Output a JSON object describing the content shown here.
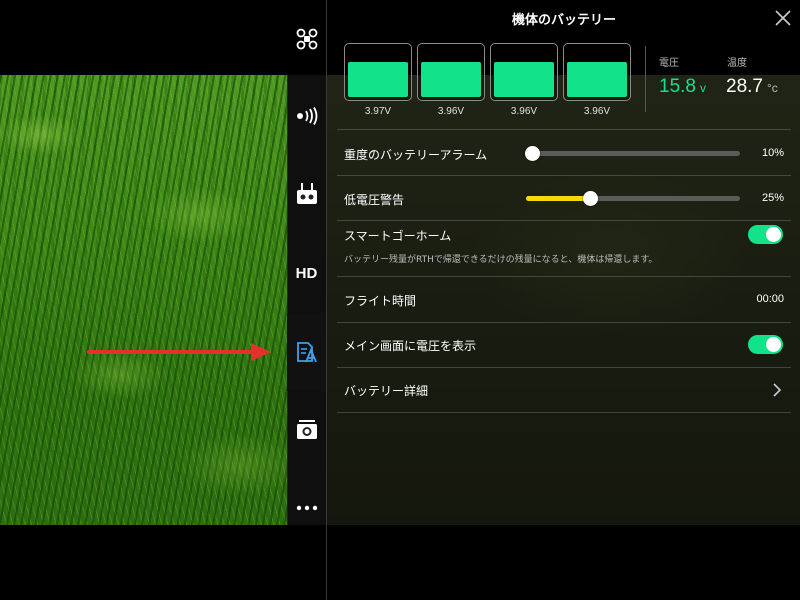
{
  "panel": {
    "title": "機体のバッテリー",
    "cells": [
      {
        "voltage": "3.97V",
        "level": 0.63
      },
      {
        "voltage": "3.96V",
        "level": 0.63
      },
      {
        "voltage": "3.96V",
        "level": 0.63
      },
      {
        "voltage": "3.96V",
        "level": 0.63
      }
    ],
    "voltage_label": "電圧",
    "voltage_value": "15.8",
    "voltage_unit": "v",
    "temp_label": "温度",
    "temp_value": "28.7",
    "temp_unit": "°c"
  },
  "settings": {
    "critical_alarm": {
      "label": "重度のバッテリーアラーム",
      "value": "10%",
      "level": 0.03
    },
    "low_voltage": {
      "label": "低電圧警告",
      "value": "25%",
      "level": 0.3
    },
    "smart_rth": {
      "label": "スマートゴーホーム",
      "on": true,
      "description": "バッテリー残量がRTHで帰還できるだけの残量になると、機体は帰還します。"
    },
    "flight_time": {
      "label": "フライト時間",
      "value": "00:00"
    },
    "show_voltage": {
      "label": "メイン画面に電圧を表示",
      "on": true
    },
    "battery_details": {
      "label": "バッテリー詳細"
    }
  },
  "toolbar": {
    "items": [
      "drone-icon",
      "signal-icon",
      "remote-controller-icon",
      "HD",
      "battery-icon",
      "camera-icon",
      "more-icon"
    ],
    "hd_label": "HD",
    "active": "battery-icon"
  },
  "colors": {
    "accent": "#12e38a",
    "warning": "#f5d90a",
    "arrow": "#e5312b",
    "active_icon": "#3aa0f0"
  }
}
